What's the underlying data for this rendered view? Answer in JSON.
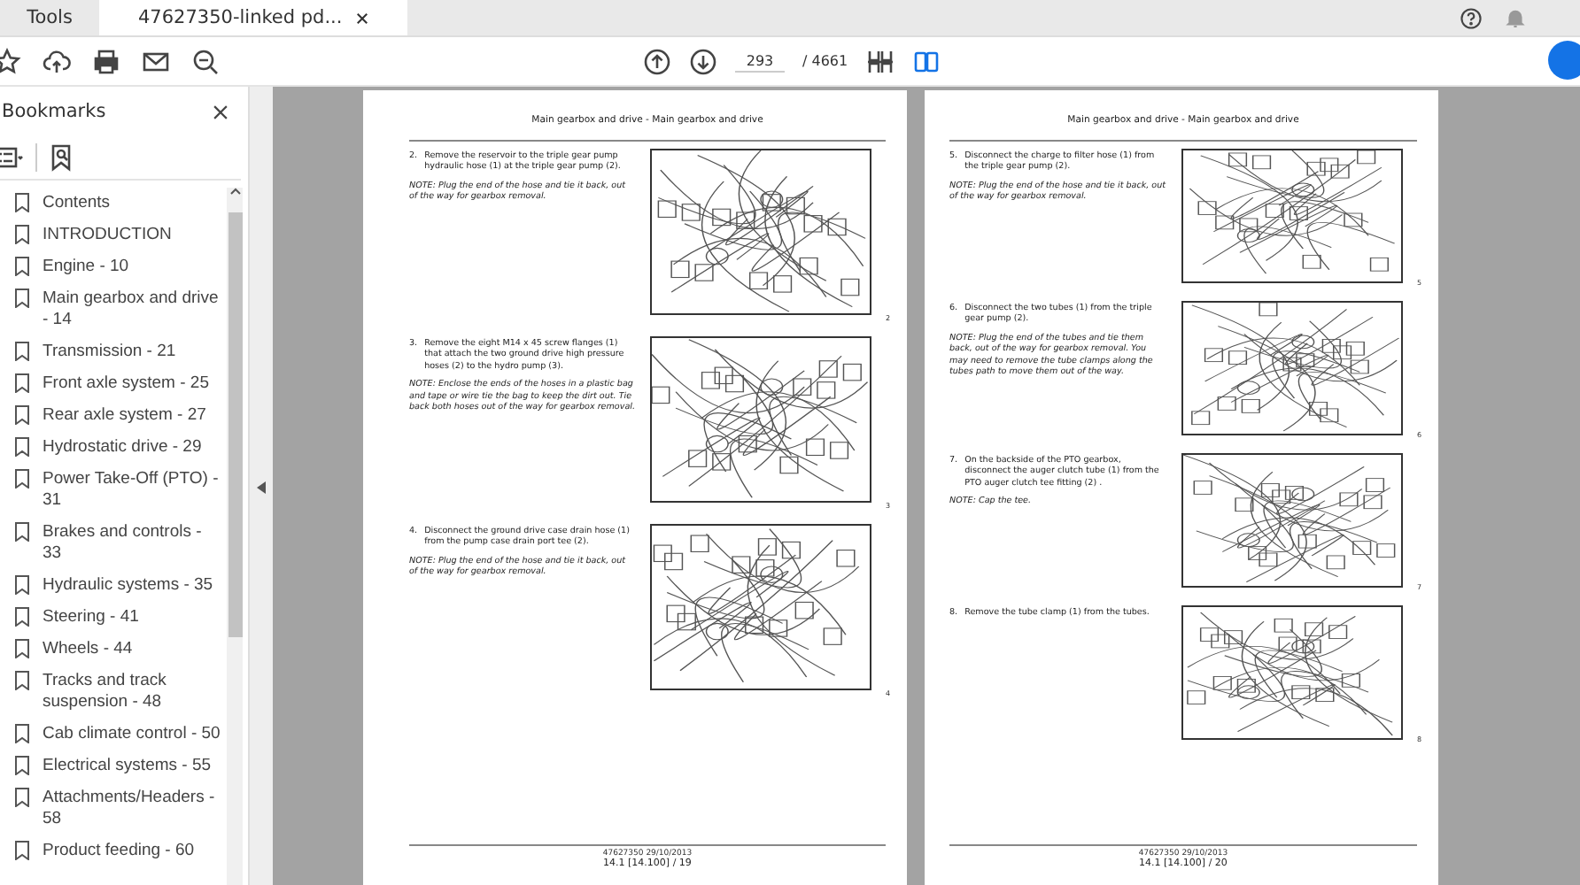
{
  "tabs": [
    {
      "label": "Tools",
      "selected": false
    },
    {
      "label": "47627350-linked pd...",
      "selected": true
    }
  ],
  "toolbar": {
    "page_field": "293",
    "page_total": "/ 4661"
  },
  "bookmarks_panel": {
    "title": "Bookmarks",
    "items": [
      {
        "label": "Contents"
      },
      {
        "label": "INTRODUCTION"
      },
      {
        "label": "Engine - 10"
      },
      {
        "label": "Main gearbox and drive - 14"
      },
      {
        "label": "Transmission - 21"
      },
      {
        "label": "Front axle system - 25"
      },
      {
        "label": "Rear axle system - 27"
      },
      {
        "label": "Hydrostatic drive - 29"
      },
      {
        "label": "Power Take-Off (PTO) - 31"
      },
      {
        "label": "Brakes and controls - 33"
      },
      {
        "label": "Hydraulic systems - 35"
      },
      {
        "label": "Steering - 41"
      },
      {
        "label": "Wheels - 44"
      },
      {
        "label": "Tracks and track suspension - 48"
      },
      {
        "label": "Cab climate control - 50"
      },
      {
        "label": "Electrical systems - 55"
      },
      {
        "label": "Attachments/Headers - 58"
      },
      {
        "label": "Product feeding - 60"
      }
    ]
  },
  "pages": [
    {
      "header": "Main gearbox and drive - Main gearbox and drive",
      "steps": [
        {
          "number": "2.",
          "text": "Remove the reservoir to the triple gear pump hydraulic hose (1) at the triple gear pump (2).",
          "note": "NOTE: Plug the end of the hose and tie it back, out of the way for gearbox removal.",
          "figure_number": "2"
        },
        {
          "number": "3.",
          "text": "Remove the eight M14 x 45 screw flanges (1) that attach the two ground drive high pressure hoses (2) to the hydro pump (3).",
          "note": "NOTE: Enclose the ends of the hoses in a plastic bag and tape or wire tie the bag to keep the dirt out. Tie back both hoses out of the way for gearbox removal.",
          "figure_number": "3"
        },
        {
          "number": "4.",
          "text": "Disconnect the ground drive case drain hose (1) from the pump case drain port tee (2).",
          "note": "NOTE: Plug the end of the hose and tie it back, out of the way for gearbox removal.",
          "figure_number": "4"
        }
      ],
      "footer_code": "47627350 29/10/2013",
      "footer_page": "14.1 [14.100] / 19"
    },
    {
      "header": "Main gearbox and drive - Main gearbox and drive",
      "steps": [
        {
          "number": "5.",
          "text": "Disconnect the charge to filter hose (1) from the triple gear pump (2).",
          "note": "NOTE: Plug the end of the hose and tie it back, out of the way for gearbox removal.",
          "figure_number": "5"
        },
        {
          "number": "6.",
          "text": "Disconnect the two tubes (1) from the triple gear pump (2).",
          "note": "NOTE: Plug the end of the tubes and tie them back, out of the way for gearbox removal. You may need to remove the tube clamps along the tubes path to move them out of the way.",
          "figure_number": "6"
        },
        {
          "number": "7.",
          "text": "On the backside of the PTO gearbox, disconnect the auger clutch tube (1) from the PTO auger clutch tee fitting (2) .",
          "note": "NOTE: Cap the tee.",
          "figure_number": "7"
        },
        {
          "number": "8.",
          "text": "Remove the tube clamp (1) from the tubes.",
          "figure_number": "8"
        }
      ],
      "footer_code": "47627350 29/10/2013",
      "footer_page": "14.1 [14.100] / 20"
    }
  ]
}
